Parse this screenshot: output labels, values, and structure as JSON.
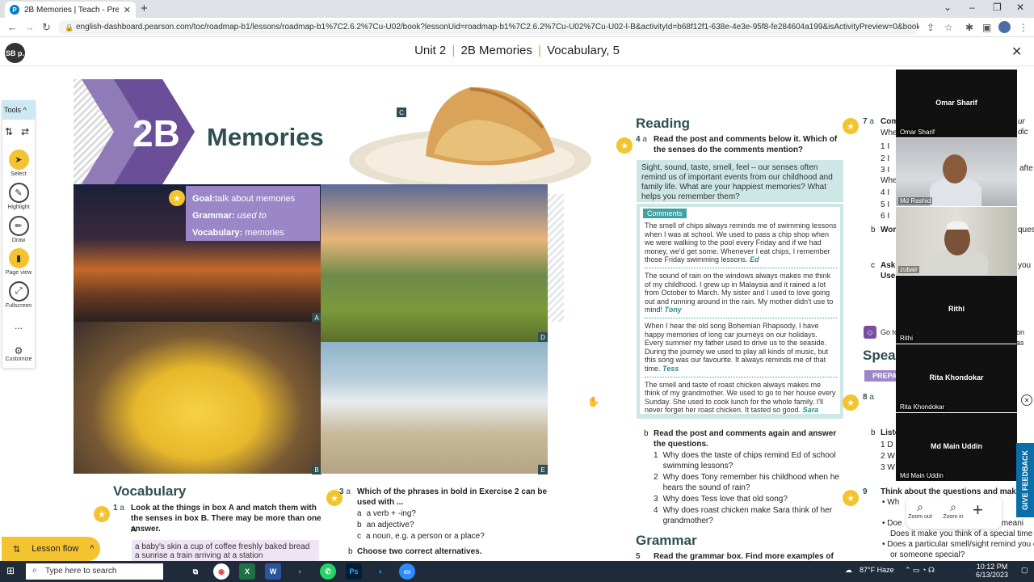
{
  "browser": {
    "tab_title": "2B Memories | Teach - Present | E",
    "url": "english-dashboard.pearson.com/toc/roadmap-b1/lessons/roadmap-b1%7C2.6.2%7Cu-U02/book?lessonUid=roadmap-b1%7C2.6.2%7Cu-U02%7Cu-U02-l-B&activityId=b68f12f1-638e-4e3e-95f8-fe284604a199&isActivityPreview=0&bookType=STUDEN..."
  },
  "header": {
    "badge": "SB p.",
    "unit": "Unit 2",
    "lesson": "2B Memories",
    "section": "Vocabulary, 5",
    "separator": "|"
  },
  "tools": {
    "title": "Tools",
    "items": [
      {
        "label": "Select"
      },
      {
        "label": "Highlight"
      },
      {
        "label": "Draw"
      },
      {
        "label": "Page view"
      },
      {
        "label": "Fullscreen"
      },
      {
        "label": "..."
      },
      {
        "label": "Customize"
      }
    ]
  },
  "left_page": {
    "unit_code": "2B",
    "title": "Memories",
    "goal_label": "Goal:",
    "goal_text": "talk about memories",
    "grammar_label": "Grammar:",
    "grammar_text": "used to",
    "vocab_label": "Vocabulary:",
    "vocab_text": "memories",
    "photo_labels": [
      "A",
      "B",
      "C",
      "D",
      "E"
    ],
    "vocabulary_heading": "Vocabulary",
    "q1_num": "1",
    "q1_sub": "a",
    "q1_text": "Look at the things in box A and match them with the senses in box B. There may be more than one answer.",
    "box_a_label": "A",
    "box_a_line1": "a baby's skin    a cup of coffee    freshly baked bread",
    "box_a_line2": "a sunrise    a train arriving at a station",
    "q3_num": "3",
    "q3_sub": "a",
    "q3_text": "Which of the phrases in bold in Exercise 2 can be used with ...",
    "q3_options": [
      {
        "letter": "a",
        "text": "a verb + -ing?"
      },
      {
        "letter": "b",
        "text": "an adjective?"
      },
      {
        "letter": "c",
        "text": "a noun, e.g. a person or a place?"
      }
    ],
    "q3b_letter": "b",
    "q3b_text": "Choose two correct alternatives.",
    "lesson_flow": "Lesson flow"
  },
  "right_page": {
    "reading_heading": "Reading",
    "q4_num": "4",
    "q4_sub": "a",
    "q4_text": "Read the post and comments below it. Which of the senses do the comments mention?",
    "post_text": "Sight, sound, taste, smell, feel – our senses often remind us of important events from our childhood and family life. What are your happiest memories? What helps you remember them?",
    "comments_tag": "Comments",
    "comments": [
      {
        "text": "The smell of chips always reminds me of swimming lessons when I was at school. We used to pass a chip shop when we were walking to the pool every Friday and if we had money, we'd get some. Whenever I eat chips, I remember those Friday swimming lessons.",
        "author": "Ed"
      },
      {
        "text": "The sound of rain on the windows always makes me think of my childhood. I grew up in Malaysia and it rained a lot from October to March. My sister and I used to love going out and running around in the rain. My mother didn't use to mind!",
        "author": "Tony"
      },
      {
        "text": "When I hear the old song Bohemian Rhapsody, I have happy memories of long car journeys on our holidays. Every summer my father used to drive us to the seaside. During the journey we used to play all kinds of music, but this song was our favourite. It always reminds me of that time.",
        "author": "Tess"
      },
      {
        "text": "The smell and taste of roast chicken always makes me think of my grandmother. We used to go to her house every Sunday. She used to cook lunch for the whole family. I'll never forget her roast chicken. It tasted so good.",
        "author": "Sara"
      }
    ],
    "q4b_letter": "b",
    "q4b_text": "Read the post and comments again and answer the questions.",
    "q4b_items": [
      {
        "n": "1",
        "text": "Why does the taste of chips remind Ed of school swimming lessons?"
      },
      {
        "n": "2",
        "text": "Why does Tony remember his childhood when he hears the sound of rain?"
      },
      {
        "n": "3",
        "text": "Why does Tess love that old song?"
      },
      {
        "n": "4",
        "text": "Why does roast chicken make Sara think of her grandmother?"
      }
    ],
    "grammar_heading": "Grammar",
    "q5_num": "5",
    "q5_text": "Read the grammar box. Find more examples of used",
    "q7_num": "7",
    "q7_sub": "a",
    "q7_text": "Com",
    "speak_heading": "Spea",
    "prepare_tag": "PREPA",
    "q8_num": "8",
    "q8_sub": "a",
    "q9_num": "9",
    "q9_text": "Think about the questions and make n",
    "q9_line1": "Does it make you think of a special time in y",
    "q9_line2": "Does a particular smell/sight remind you of",
    "q9_line3": "or someone special?",
    "goto_text": "Go to",
    "right_fragments": [
      "ur dic",
      "afte",
      "ques",
      "you",
      "on as",
      "Whe",
      "Wor",
      "Ask",
      "Use",
      "Liste",
      "Whe",
      "Doe",
      "cial meani"
    ]
  },
  "participants": [
    {
      "name": "Omar Sharif",
      "label": "Omar Sharif",
      "camera": false
    },
    {
      "name": "Md Rashid",
      "label": "Md Rashid",
      "camera": true
    },
    {
      "name": "zubair",
      "label": "zubair",
      "camera": true
    },
    {
      "name": "Rithi",
      "label": "Rithi",
      "camera": false
    },
    {
      "name": "Rita Khondokar",
      "label": "Rita Khondokar",
      "camera": false
    },
    {
      "name": "Md Main Uddin",
      "label": "Md Main Uddin",
      "camera": false
    }
  ],
  "feedback": "GIVE FEEDBACK",
  "zoom": {
    "out": "Zoom out",
    "in": "Zoom in"
  },
  "taskbar": {
    "search_placeholder": "Type here to search",
    "weather": "87°F  Haze",
    "time": "10:12 PM",
    "date": "6/13/2023"
  }
}
